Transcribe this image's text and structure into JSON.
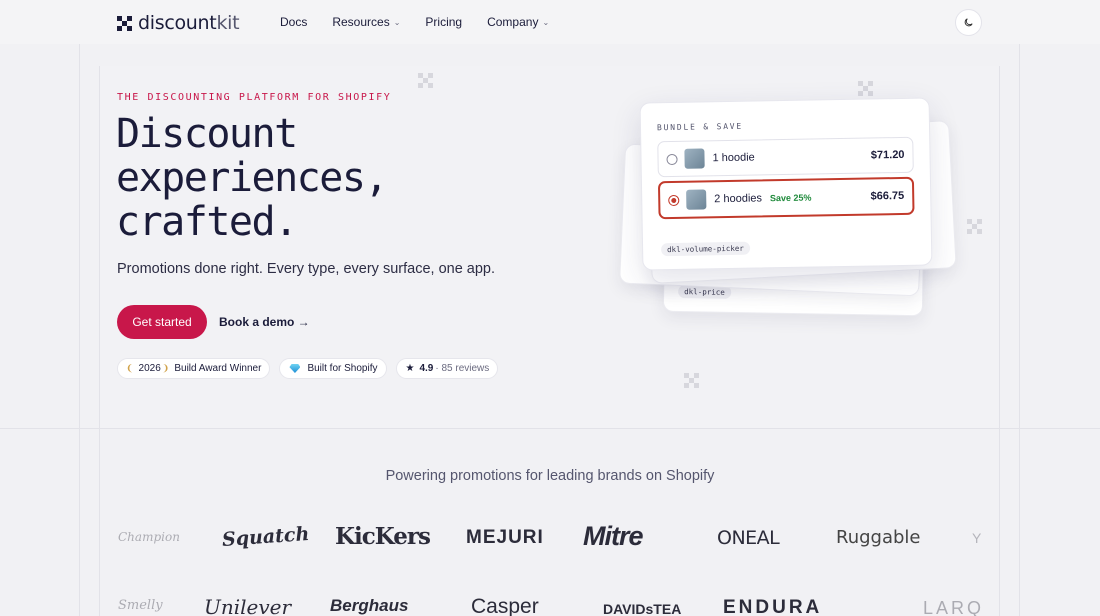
{
  "nav": {
    "logo_main": "discount",
    "logo_light": "kit",
    "links": [
      {
        "label": "Docs",
        "dropdown": false
      },
      {
        "label": "Resources",
        "dropdown": true
      },
      {
        "label": "Pricing",
        "dropdown": false
      },
      {
        "label": "Company",
        "dropdown": true
      }
    ],
    "theme_icon": "moon-icon"
  },
  "hero": {
    "eyebrow": "THE DISCOUNTING PLATFORM FOR SHOPIFY",
    "headline_1": "Discount",
    "headline_2": "experiences,",
    "headline_3": "crafted.",
    "subhead": "Promotions done right. Every type, every surface, one app.",
    "cta_primary": "Get started",
    "cta_secondary": "Book a demo →",
    "badges": {
      "award_year": "2026",
      "award_label": "Build Award Winner",
      "shopify_label": "Built for Shopify",
      "rating": "4.9",
      "reviews": "· 85 reviews"
    }
  },
  "widget": {
    "eyebrow": "BUNDLE & SAVE",
    "options": [
      {
        "label": "1 hoodie",
        "save": "",
        "price": "$71.20",
        "selected": false
      },
      {
        "label": "2 hoodies",
        "save": "Save 25%",
        "price": "$66.75",
        "selected": true
      }
    ],
    "tag_main": "dkl-volume-picker",
    "tag_back": "dkl-price"
  },
  "brands": {
    "title": "Powering promotions for leading brands on Shopify",
    "row1": [
      "Champion",
      "Squatch",
      "KicKers",
      "MEJURI",
      "Mitre",
      "ONEAL",
      "Ruggable",
      "Y"
    ],
    "row2": [
      "Smelly",
      "Unilever",
      "Berghaus",
      "Casper",
      "DAVIDsTEA",
      "ENDURA",
      "LARQ"
    ]
  },
  "colors": {
    "accent": "#c8174a",
    "ink": "#1b1c3a",
    "save_green": "#1f8a3b",
    "selected_border": "#c23a2b"
  }
}
